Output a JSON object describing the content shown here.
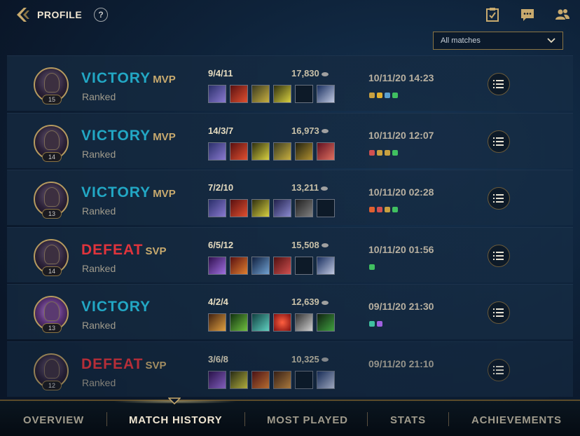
{
  "header": {
    "title": "PROFILE",
    "help_icon": "?",
    "icons": [
      "missions-icon",
      "chat-icon",
      "friends-icon"
    ]
  },
  "filter": {
    "selected": "All matches"
  },
  "matches": [
    {
      "result": "VICTORY",
      "badge": "MVP",
      "mode": "Ranked",
      "level": "15",
      "kda": "9/4/11",
      "gold": "17,830",
      "date": "10/11/20 14:23"
    },
    {
      "result": "VICTORY",
      "badge": "MVP",
      "mode": "Ranked",
      "level": "14",
      "kda": "14/3/7",
      "gold": "16,973",
      "date": "10/11/20 12:07"
    },
    {
      "result": "VICTORY",
      "badge": "MVP",
      "mode": "Ranked",
      "level": "13",
      "kda": "7/2/10",
      "gold": "13,211",
      "date": "10/11/20 02:28"
    },
    {
      "result": "DEFEAT",
      "badge": "SVP",
      "mode": "Ranked",
      "level": "14",
      "kda": "6/5/12",
      "gold": "15,508",
      "date": "10/11/20 01:56"
    },
    {
      "result": "VICTORY",
      "badge": "",
      "mode": "Ranked",
      "level": "13",
      "kda": "4/2/4",
      "gold": "12,639",
      "date": "09/11/20 21:30"
    },
    {
      "result": "DEFEAT",
      "badge": "SVP",
      "mode": "Ranked",
      "level": "12",
      "kda": "3/6/8",
      "gold": "10,325",
      "date": "09/11/20 21:10"
    }
  ],
  "colors": {
    "victory": "#22a7c4",
    "defeat": "#e0343c",
    "gold_accent": "#c8aa6e"
  },
  "nav": {
    "tabs": [
      "OVERVIEW",
      "MATCH HISTORY",
      "MOST PLAYED",
      "STATS",
      "ACHIEVEMENTS"
    ],
    "active": "MATCH HISTORY"
  }
}
